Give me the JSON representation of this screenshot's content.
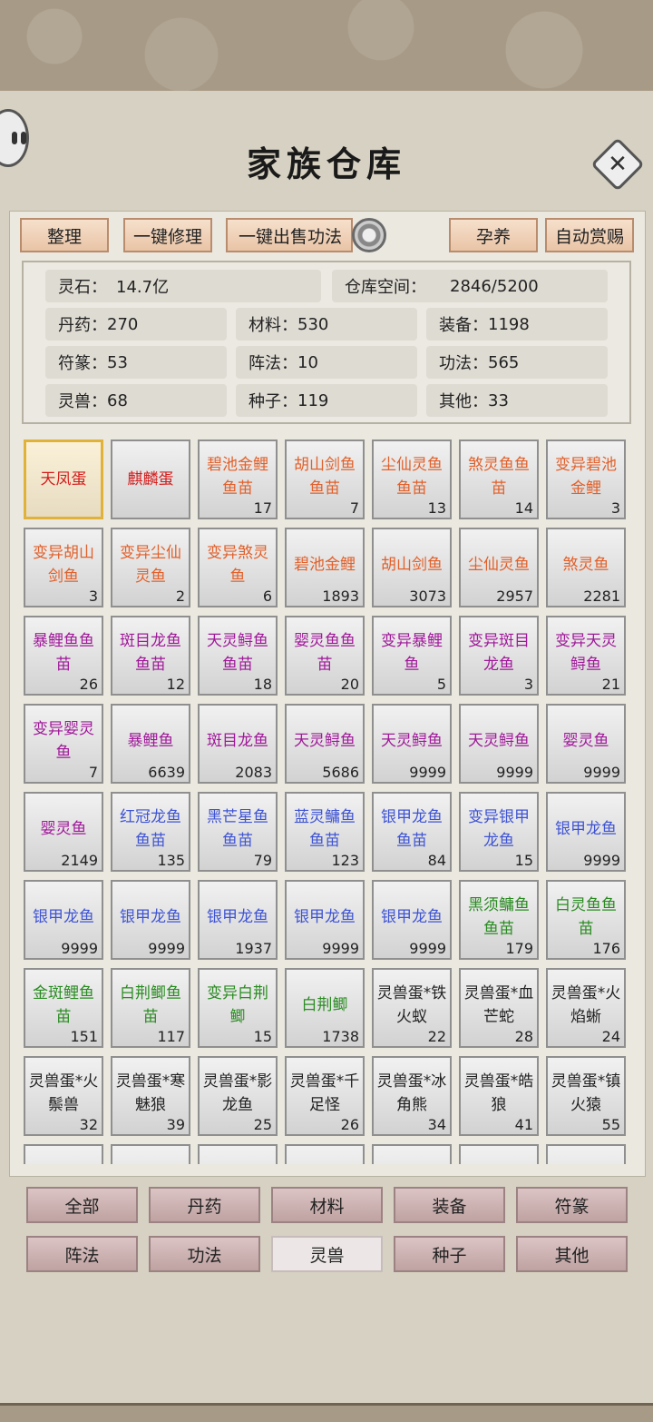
{
  "title": "家族仓库",
  "toolbar": {
    "sort_label": "整理",
    "repair_label": "一键修理",
    "sell_label": "一键出售功法",
    "breed_label": "孕养",
    "reward_label": "自动赏赐"
  },
  "stats": {
    "spirit_stone": {
      "label": "灵石：",
      "value": "14.7亿"
    },
    "storage": {
      "label": "仓库空间：",
      "value": "2846/5200"
    },
    "pills": {
      "label": "丹药：",
      "value": "270"
    },
    "materials": {
      "label": "材料：",
      "value": "530"
    },
    "equipment": {
      "label": "装备：",
      "value": "1198"
    },
    "talismans": {
      "label": "符篆：",
      "value": "53"
    },
    "formations": {
      "label": "阵法：",
      "value": "10"
    },
    "skills": {
      "label": "功法：",
      "value": "565"
    },
    "beasts": {
      "label": "灵兽：",
      "value": "68"
    },
    "seeds": {
      "label": "种子：",
      "value": "119"
    },
    "other": {
      "label": "其他：",
      "value": "33"
    }
  },
  "colors": {
    "red": "#d41c1c",
    "orange": "#e2602a",
    "purple": "#a0189a",
    "blue": "#3f54d4",
    "green": "#2a8c22",
    "black": "#222222"
  },
  "items": [
    {
      "name": "天凤蛋",
      "count": "",
      "color": "red",
      "selected": true
    },
    {
      "name": "麒麟蛋",
      "count": "",
      "color": "red"
    },
    {
      "name": "碧池金鲤鱼苗",
      "count": "17",
      "color": "orange"
    },
    {
      "name": "胡山剑鱼鱼苗",
      "count": "7",
      "color": "orange"
    },
    {
      "name": "尘仙灵鱼鱼苗",
      "count": "13",
      "color": "orange"
    },
    {
      "name": "煞灵鱼鱼苗",
      "count": "14",
      "color": "orange"
    },
    {
      "name": "变异碧池金鲤",
      "count": "3",
      "color": "orange"
    },
    {
      "name": "变异胡山剑鱼",
      "count": "3",
      "color": "orange"
    },
    {
      "name": "变异尘仙灵鱼",
      "count": "2",
      "color": "orange"
    },
    {
      "name": "变异煞灵鱼",
      "count": "6",
      "color": "orange"
    },
    {
      "name": "碧池金鲤",
      "count": "1893",
      "color": "orange"
    },
    {
      "name": "胡山剑鱼",
      "count": "3073",
      "color": "orange"
    },
    {
      "name": "尘仙灵鱼",
      "count": "2957",
      "color": "orange"
    },
    {
      "name": "煞灵鱼",
      "count": "2281",
      "color": "orange"
    },
    {
      "name": "暴鲤鱼鱼苗",
      "count": "26",
      "color": "purple"
    },
    {
      "name": "斑目龙鱼鱼苗",
      "count": "12",
      "color": "purple"
    },
    {
      "name": "天灵鲟鱼鱼苗",
      "count": "18",
      "color": "purple"
    },
    {
      "name": "婴灵鱼鱼苗",
      "count": "20",
      "color": "purple"
    },
    {
      "name": "变异暴鲤鱼",
      "count": "5",
      "color": "purple"
    },
    {
      "name": "变异斑目龙鱼",
      "count": "3",
      "color": "purple"
    },
    {
      "name": "变异天灵鲟鱼",
      "count": "21",
      "color": "purple"
    },
    {
      "name": "变异婴灵鱼",
      "count": "7",
      "color": "purple"
    },
    {
      "name": "暴鲤鱼",
      "count": "6639",
      "color": "purple"
    },
    {
      "name": "斑目龙鱼",
      "count": "2083",
      "color": "purple"
    },
    {
      "name": "天灵鲟鱼",
      "count": "5686",
      "color": "purple"
    },
    {
      "name": "天灵鲟鱼",
      "count": "9999",
      "color": "purple"
    },
    {
      "name": "天灵鲟鱼",
      "count": "9999",
      "color": "purple"
    },
    {
      "name": "婴灵鱼",
      "count": "9999",
      "color": "purple"
    },
    {
      "name": "婴灵鱼",
      "count": "2149",
      "color": "purple"
    },
    {
      "name": "红冠龙鱼鱼苗",
      "count": "135",
      "color": "blue"
    },
    {
      "name": "黑芒星鱼鱼苗",
      "count": "79",
      "color": "blue"
    },
    {
      "name": "蓝灵鳙鱼鱼苗",
      "count": "123",
      "color": "blue"
    },
    {
      "name": "银甲龙鱼鱼苗",
      "count": "84",
      "color": "blue"
    },
    {
      "name": "变异银甲龙鱼",
      "count": "15",
      "color": "blue"
    },
    {
      "name": "银甲龙鱼",
      "count": "9999",
      "color": "blue"
    },
    {
      "name": "银甲龙鱼",
      "count": "9999",
      "color": "blue"
    },
    {
      "name": "银甲龙鱼",
      "count": "9999",
      "color": "blue"
    },
    {
      "name": "银甲龙鱼",
      "count": "1937",
      "color": "blue"
    },
    {
      "name": "银甲龙鱼",
      "count": "9999",
      "color": "blue"
    },
    {
      "name": "银甲龙鱼",
      "count": "9999",
      "color": "blue"
    },
    {
      "name": "黑须鳙鱼鱼苗",
      "count": "179",
      "color": "green"
    },
    {
      "name": "白灵鱼鱼苗",
      "count": "176",
      "color": "green"
    },
    {
      "name": "金斑鲤鱼苗",
      "count": "151",
      "color": "green"
    },
    {
      "name": "白荆鲫鱼苗",
      "count": "117",
      "color": "green"
    },
    {
      "name": "变异白荆鲫",
      "count": "15",
      "color": "green"
    },
    {
      "name": "白荆鲫",
      "count": "1738",
      "color": "green"
    },
    {
      "name": "灵兽蛋*铁火蚁",
      "count": "22",
      "color": "black"
    },
    {
      "name": "灵兽蛋*血芒蛇",
      "count": "28",
      "color": "black"
    },
    {
      "name": "灵兽蛋*火焰蜥",
      "count": "24",
      "color": "black"
    },
    {
      "name": "灵兽蛋*火鬃兽",
      "count": "32",
      "color": "black"
    },
    {
      "name": "灵兽蛋*寒魅狼",
      "count": "39",
      "color": "black"
    },
    {
      "name": "灵兽蛋*影龙鱼",
      "count": "25",
      "color": "black"
    },
    {
      "name": "灵兽蛋*千足怪",
      "count": "26",
      "color": "black"
    },
    {
      "name": "灵兽蛋*冰角熊",
      "count": "34",
      "color": "black"
    },
    {
      "name": "灵兽蛋*皓狼",
      "count": "41",
      "color": "black"
    },
    {
      "name": "灵兽蛋*镇火猿",
      "count": "55",
      "color": "black"
    }
  ],
  "tabs": [
    {
      "label": "全部"
    },
    {
      "label": "丹药"
    },
    {
      "label": "材料"
    },
    {
      "label": "装备"
    },
    {
      "label": "符篆"
    },
    {
      "label": "阵法"
    },
    {
      "label": "功法"
    },
    {
      "label": "灵兽",
      "active": true
    },
    {
      "label": "种子"
    },
    {
      "label": "其他"
    }
  ]
}
